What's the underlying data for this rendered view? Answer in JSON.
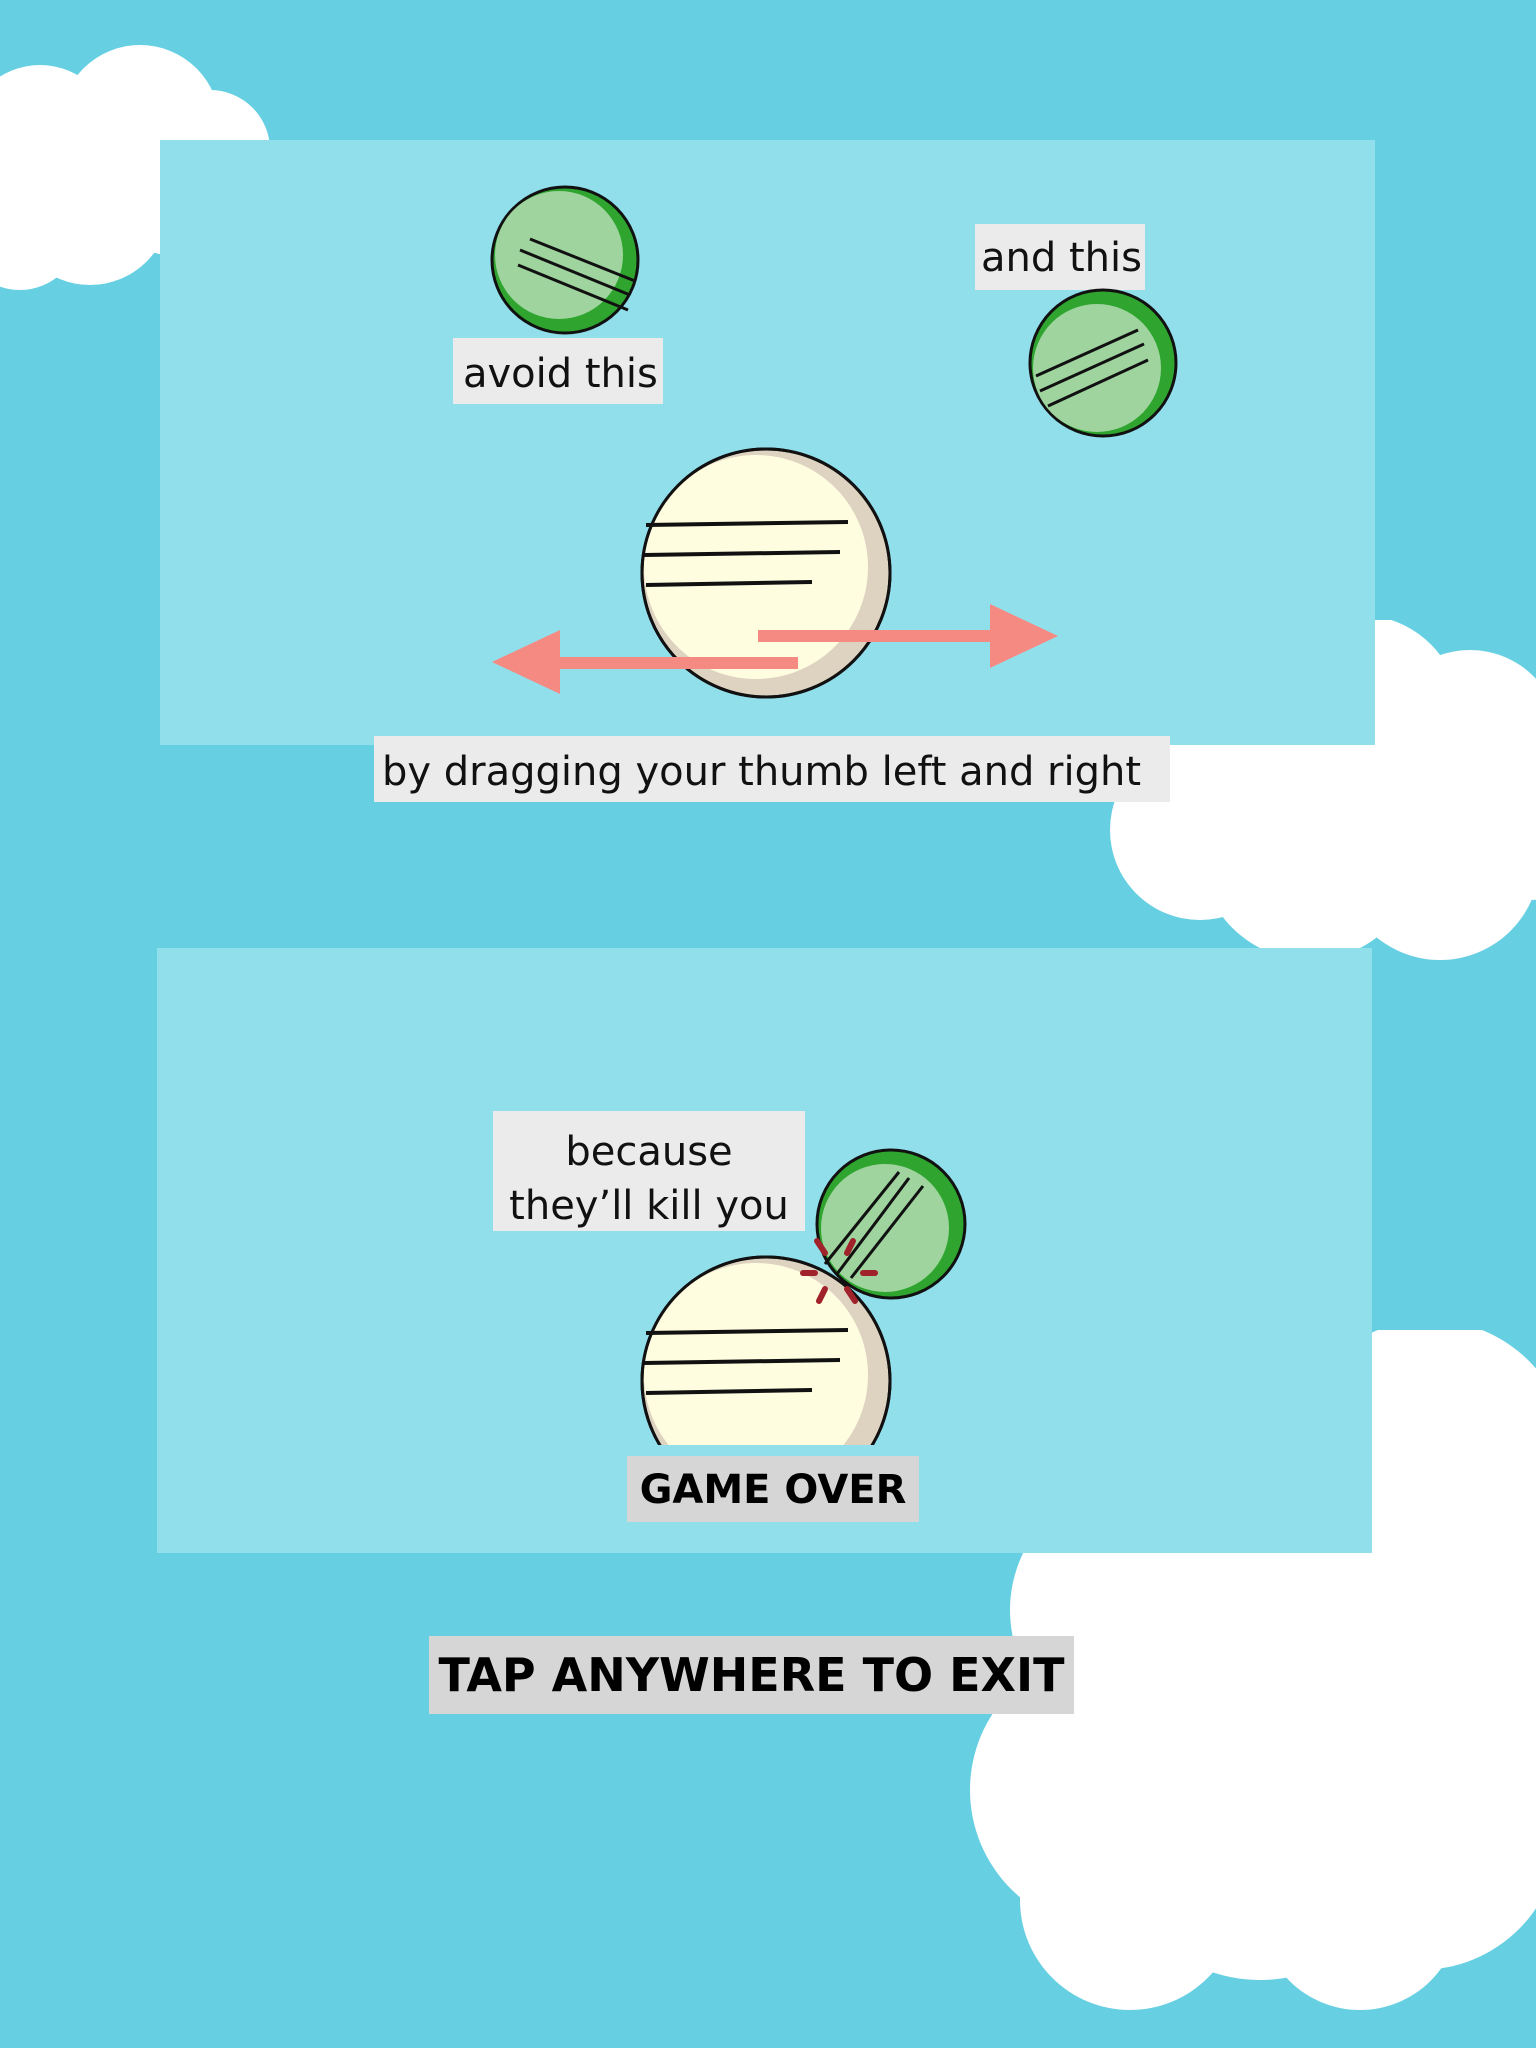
{
  "tutorial": {
    "avoid_label": "avoid this",
    "and_label": "and this",
    "drag_label": "by dragging your thumb left and right",
    "because_line1": "because",
    "because_line2": "they’ll kill you",
    "game_over": "GAME OVER"
  },
  "exit": {
    "label": "TAP ANYWHERE TO EXIT"
  },
  "icons": {
    "enemy": "green-pill-icon",
    "player": "cream-pill-icon",
    "drag": "double-arrow-icon",
    "hit": "impact-spark-icon"
  },
  "colors": {
    "sky": "#66cfe2",
    "panel": "#92dfec",
    "enemy_fill": "#9fd49f",
    "enemy_rim": "#2fa52f",
    "player_fill": "#fffde0",
    "player_rim": "#ddd3c0",
    "arrow": "#f58a82",
    "spark": "#a0222a"
  }
}
